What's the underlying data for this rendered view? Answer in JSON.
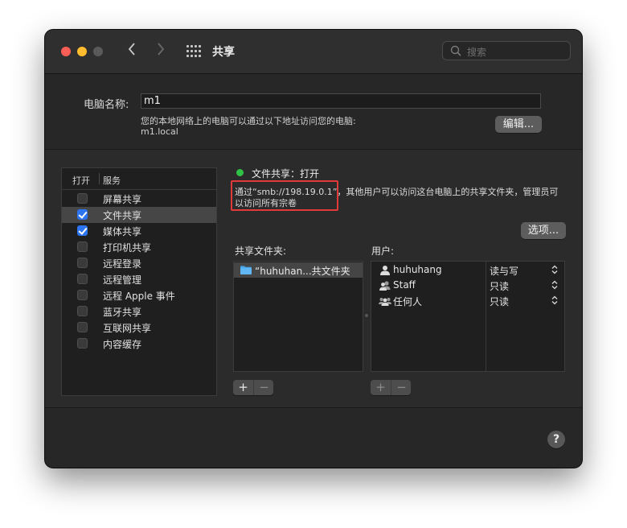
{
  "window": {
    "title": "共享",
    "search": {
      "placeholder": "搜索"
    }
  },
  "computer": {
    "name_label": "电脑名称:",
    "name_value": "m1",
    "hint": "您的本地网络上的电脑可以通过以下地址访问您的电脑:",
    "address": "m1.local",
    "edit_button": "编辑..."
  },
  "services": {
    "header_on": "打开",
    "header_service": "服务",
    "items": [
      {
        "label": "屏幕共享",
        "checked": false,
        "selected": false
      },
      {
        "label": "文件共享",
        "checked": true,
        "selected": true
      },
      {
        "label": "媒体共享",
        "checked": true,
        "selected": false
      },
      {
        "label": "打印机共享",
        "checked": false,
        "selected": false
      },
      {
        "label": "远程登录",
        "checked": false,
        "selected": false
      },
      {
        "label": "远程管理",
        "checked": false,
        "selected": false
      },
      {
        "label": "远程 Apple 事件",
        "checked": false,
        "selected": false
      },
      {
        "label": "蓝牙共享",
        "checked": false,
        "selected": false
      },
      {
        "label": "互联网共享",
        "checked": false,
        "selected": false
      },
      {
        "label": "内容缓存",
        "checked": false,
        "selected": false
      }
    ]
  },
  "detail": {
    "status": "文件共享：打开",
    "status_color": "#2fc246",
    "description_line1": "通过“smb://198.19.0.1”，其他用户可以访问这台电脑上的共享文件夹，管理员可",
    "description_line2": "以访问所有宗卷",
    "options_button": "选项...",
    "shared_folders_label": "共享文件夹:",
    "shared_folders": [
      {
        "name": "“huhuhan...共文件夹",
        "icon": "folder-icon"
      }
    ],
    "users_label": "用户:",
    "users": [
      {
        "name": "huhuhang",
        "permission": "读与写",
        "icon": "single-user-icon"
      },
      {
        "name": "Staff",
        "permission": "只读",
        "icon": "group-icon"
      },
      {
        "name": "任何人",
        "permission": "只读",
        "icon": "everyone-icon"
      }
    ],
    "add_symbol": "+",
    "remove_symbol": "−"
  },
  "help": {
    "label": "?"
  },
  "colors": {
    "highlight_border": "#e03a3a",
    "checkbox_checked": "#2c74f0"
  }
}
